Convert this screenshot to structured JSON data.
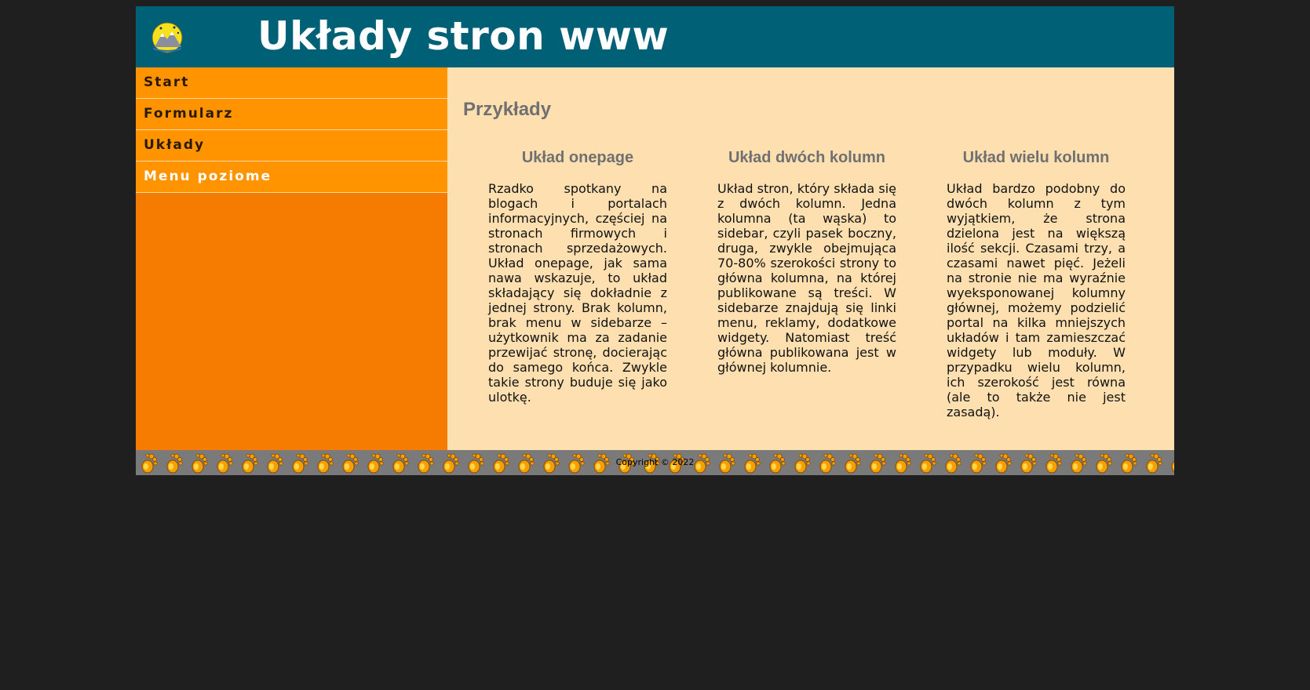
{
  "header": {
    "title": "Układy stron www",
    "logo_icon": "mountain-sun-logo-icon"
  },
  "sidebar": {
    "items": [
      {
        "label": "Start"
      },
      {
        "label": "Formularz"
      },
      {
        "label": "Układy"
      },
      {
        "label": "Menu poziome"
      }
    ]
  },
  "main": {
    "heading": "Przykłady",
    "columns": [
      {
        "title": "Układ onepage",
        "text": "Rzadko spotkany na blogach i portalach informacyjnych, częściej na stronach firmowych i stronach sprzedażowych. Układ onepage, jak sama nawa wskazuje, to układ składający się dokładnie z jednej strony. Brak kolumn, brak menu w sidebarze – użytkownik ma za zadanie przewijać stronę, docierając do samego końca. Zwykle takie strony buduje się jako ulotkę."
      },
      {
        "title": "Układ dwóch kolumn",
        "text": "Układ stron, który składa się z dwóch kolumn. Jedna kolumna (ta wąska) to sidebar, czyli pasek boczny, druga, zwykle obejmująca 70-80% szerokości strony to główna kolumna, na której publikowane są treści. W sidebarze znajdują się linki menu, reklamy, dodatkowe widgety. Natomiast treść główna publikowana jest w głównej kolumnie."
      },
      {
        "title": "Układ wielu kolumn",
        "text": "Układ bardzo podobny do dwóch kolumn z tym wyjątkiem, że strona dzielona jest na większą ilość sekcji. Czasami trzy, a czasami nawet pięć. Jeżeli na stronie nie ma wyraźnie wyeksponowanej kolumny głównej, możemy podzielić portal na kilka mniejszych układów i tam zamieszczać widgety lub moduły. W przypadku wielu kolumn, ich szerokość jest równa (ale to także nie jest zasadą)."
      }
    ]
  },
  "footer": {
    "copyright": "Copyright © 2022",
    "pattern_icon": "paw-print-icon"
  },
  "colors": {
    "page_bg": "#1f1f1f",
    "header_bg": "#006075",
    "sidebar_bg": "#f57c00",
    "menu_item_bg": "#ff9400",
    "main_bg": "#fedfb0",
    "footer_bg": "#7a7a7a"
  }
}
